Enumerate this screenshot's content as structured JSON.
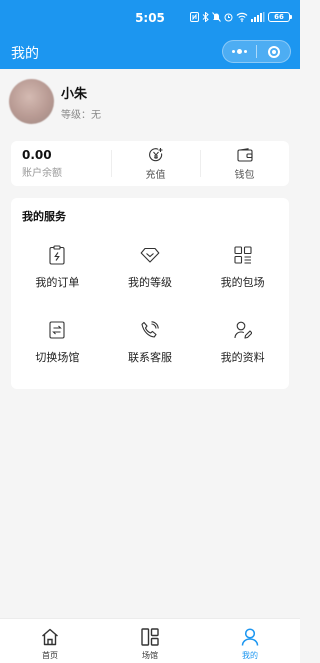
{
  "status_bar": {
    "time": "5:05",
    "battery": "66"
  },
  "header": {
    "title": "我的"
  },
  "profile": {
    "name": "小朱",
    "level_text": "等级：无"
  },
  "balance": {
    "amount": "0.00",
    "amount_label": "账户余额",
    "recharge_label": "充值",
    "wallet_label": "钱包"
  },
  "services": {
    "title": "我的服务",
    "items": [
      {
        "label": "我的订单",
        "icon": "order-icon"
      },
      {
        "label": "我的等级",
        "icon": "level-icon"
      },
      {
        "label": "我的包场",
        "icon": "booking-icon"
      },
      {
        "label": "切换场馆",
        "icon": "switch-icon"
      },
      {
        "label": "联系客服",
        "icon": "phone-icon"
      },
      {
        "label": "我的资料",
        "icon": "profile-edit-icon"
      }
    ]
  },
  "tabbar": {
    "items": [
      {
        "label": "首页",
        "icon": "home-icon",
        "active": false
      },
      {
        "label": "场馆",
        "icon": "venue-icon",
        "active": false
      },
      {
        "label": "我的",
        "icon": "user-icon",
        "active": true
      }
    ]
  },
  "colors": {
    "brand": "#1c96f0",
    "background": "#f5f5f5",
    "card": "#ffffff"
  }
}
